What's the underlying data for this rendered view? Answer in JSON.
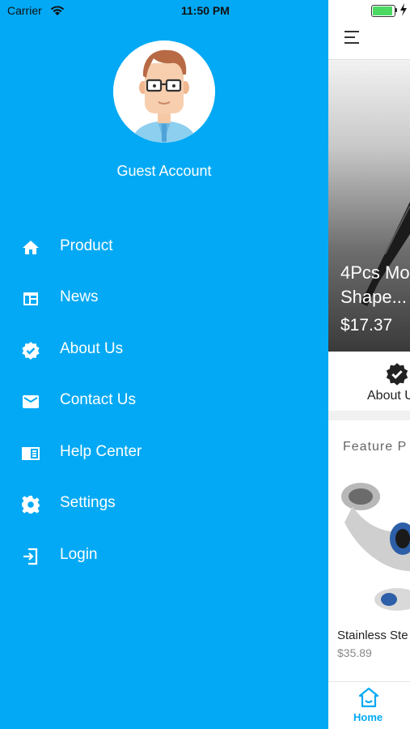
{
  "status_bar": {
    "carrier": "Carrier",
    "time": "11:50 PM"
  },
  "drawer": {
    "account_name": "Guest Account",
    "items": [
      {
        "label": "Product",
        "icon": "home-icon"
      },
      {
        "label": "News",
        "icon": "news-icon"
      },
      {
        "label": "About Us",
        "icon": "verified-badge-icon"
      },
      {
        "label": "Contact Us",
        "icon": "mail-icon"
      },
      {
        "label": "Help Center",
        "icon": "help-book-icon"
      },
      {
        "label": "Settings",
        "icon": "gear-icon"
      },
      {
        "label": "Login",
        "icon": "login-icon"
      }
    ]
  },
  "content": {
    "banner": {
      "title": "4Pcs Mo\nShape...",
      "price": "$17.37"
    },
    "about_label": "About U",
    "feature_label": "Feature P",
    "product": {
      "name": "Stainless Ste",
      "price": "$35.89"
    },
    "tab_bar": {
      "home_label": "Home"
    }
  },
  "colors": {
    "accent": "#03A9F4",
    "drawer_bg": "#03A9F4",
    "battery": "#4CD964"
  }
}
